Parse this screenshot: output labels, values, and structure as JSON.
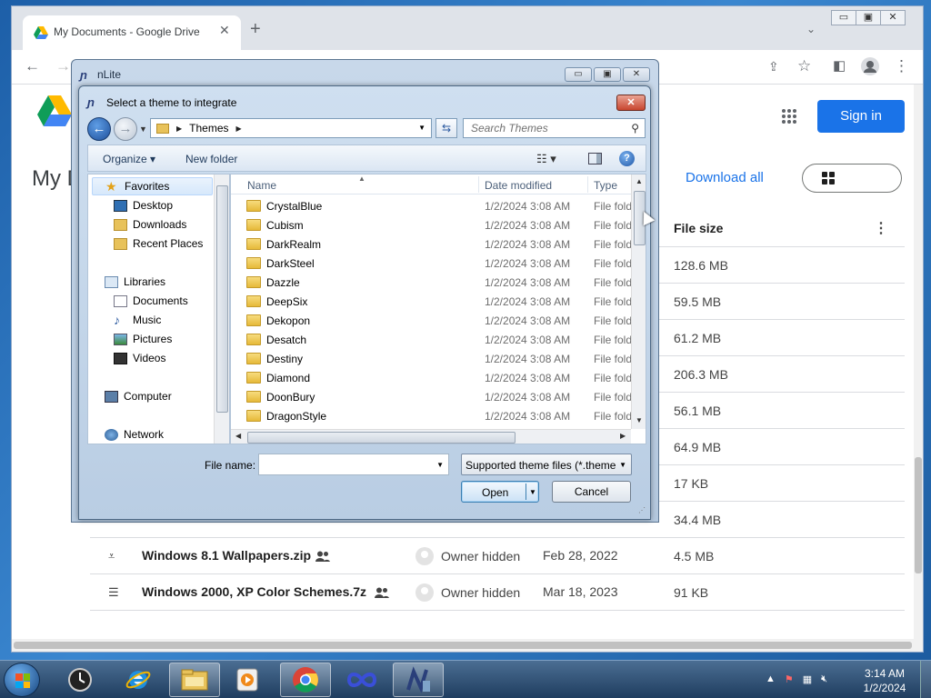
{
  "browser": {
    "tab_title": "My Documents - Google Drive",
    "tab_close": "✕",
    "new_tab": "+",
    "tab_menu": "⌄",
    "min": "▭",
    "max": "▣",
    "close": "✕"
  },
  "drive": {
    "signin_label": "Sign in",
    "page_title": "My D",
    "download_all": "Download all",
    "column_file_size": "File size",
    "sizes_above": [
      "128.6 MB",
      "59.5 MB",
      "61.2 MB",
      "206.3 MB",
      "56.1 MB",
      "64.9 MB",
      "17 KB",
      "34.4 MB"
    ],
    "rows": [
      {
        "name": "Windows 8.1 Wallpapers.zip",
        "owner": "Owner hidden",
        "modified": "Feb 28, 2022",
        "size": "4.5 MB"
      },
      {
        "name": "Windows 2000, XP Color Schemes.7z",
        "owner": "Owner hidden",
        "modified": "Mar 18, 2023",
        "size": "91 KB"
      }
    ]
  },
  "nlite": {
    "title": "nLite",
    "min": "▭",
    "max": "▣",
    "close": "✕"
  },
  "dialog": {
    "title": "Select a theme to integrate",
    "close": "✕",
    "address_crumb": "Themes",
    "search_placeholder": "Search Themes",
    "organize": "Organize ▾",
    "new_folder": "New folder",
    "nav": {
      "favorites": "Favorites",
      "desktop": "Desktop",
      "downloads": "Downloads",
      "recent": "Recent Places",
      "libraries": "Libraries",
      "documents": "Documents",
      "music": "Music",
      "pictures": "Pictures",
      "videos": "Videos",
      "computer": "Computer",
      "network": "Network"
    },
    "columns": {
      "name": "Name",
      "date": "Date modified",
      "type": "Type"
    },
    "files": [
      {
        "name": "CrystalBlue",
        "date": "1/2/2024 3:08 AM",
        "type": "File folder"
      },
      {
        "name": "Cubism",
        "date": "1/2/2024 3:08 AM",
        "type": "File folder"
      },
      {
        "name": "DarkRealm",
        "date": "1/2/2024 3:08 AM",
        "type": "File folder"
      },
      {
        "name": "DarkSteel",
        "date": "1/2/2024 3:08 AM",
        "type": "File folder"
      },
      {
        "name": "Dazzle",
        "date": "1/2/2024 3:08 AM",
        "type": "File folder"
      },
      {
        "name": "DeepSix",
        "date": "1/2/2024 3:08 AM",
        "type": "File folder"
      },
      {
        "name": "Dekopon",
        "date": "1/2/2024 3:08 AM",
        "type": "File folder"
      },
      {
        "name": "Desatch",
        "date": "1/2/2024 3:08 AM",
        "type": "File folder"
      },
      {
        "name": "Destiny",
        "date": "1/2/2024 3:08 AM",
        "type": "File folder"
      },
      {
        "name": "Diamond",
        "date": "1/2/2024 3:08 AM",
        "type": "File folder"
      },
      {
        "name": "DoonBury",
        "date": "1/2/2024 3:08 AM",
        "type": "File folder"
      },
      {
        "name": "DragonStyle",
        "date": "1/2/2024 3:08 AM",
        "type": "File folder"
      }
    ],
    "file_name_label": "File name:",
    "file_name_value": "",
    "file_type": "Supported theme files (*.theme",
    "open_label": "Open",
    "cancel_label": "Cancel"
  },
  "taskbar": {
    "time": "3:14 AM",
    "date": "1/2/2024"
  }
}
